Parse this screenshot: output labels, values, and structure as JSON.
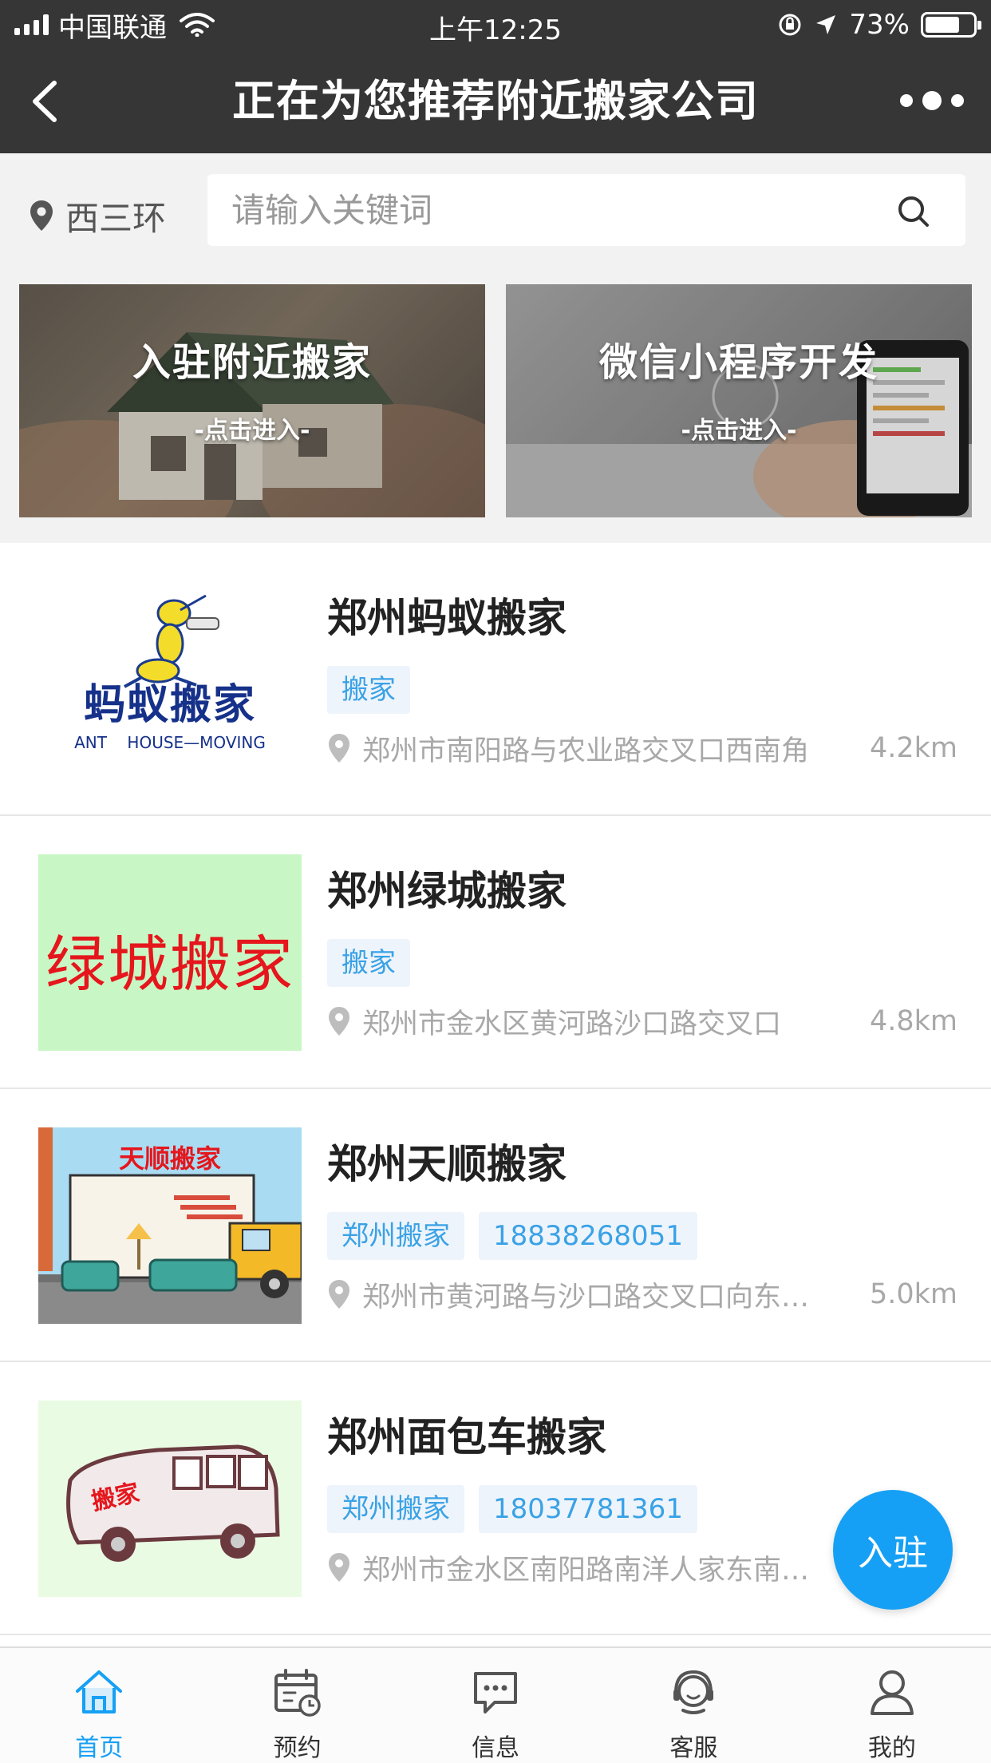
{
  "status_bar": {
    "carrier": "中国联通",
    "time": "上午12:25",
    "battery": "73%",
    "battery_level": 0.73
  },
  "nav": {
    "title": "正在为您推荐附近搬家公司"
  },
  "location": {
    "text": "西三环"
  },
  "search": {
    "placeholder": "请输入关键词"
  },
  "banners": [
    {
      "title": "入驻附近搬家",
      "subtitle": "-点击进入-"
    },
    {
      "title": "微信小程序开发",
      "subtitle": "-点击进入-"
    }
  ],
  "companies": [
    {
      "name": "郑州蚂蚁搬家",
      "tags": [
        "搬家"
      ],
      "address": "郑州市南阳路与农业路交叉口西南角",
      "distance": "4.2km",
      "logo": {
        "text": "蚂蚁搬家",
        "subtext": "ANT    HOUSE—MOVING"
      }
    },
    {
      "name": "郑州绿城搬家",
      "tags": [
        "搬家"
      ],
      "address": "郑州市金水区黄河路沙口路交叉口",
      "distance": "4.8km",
      "logo": {
        "text": "绿城搬家"
      }
    },
    {
      "name": "郑州天顺搬家",
      "tags": [
        "郑州搬家",
        "18838268051"
      ],
      "address": "郑州市黄河路与沙口路交叉口向东…",
      "distance": "5.0km",
      "logo": {
        "text": "天顺搬家"
      }
    },
    {
      "name": "郑州面包车搬家",
      "tags": [
        "郑州搬家",
        "18037781361"
      ],
      "address": "郑州市金水区南阳路南洋人家东南…",
      "distance": "",
      "logo": {
        "text": "搬家"
      }
    }
  ],
  "float_button": {
    "label": "入驻"
  },
  "tabs": [
    {
      "label": "首页",
      "icon": "home-icon",
      "active": true
    },
    {
      "label": "预约",
      "icon": "calendar-icon",
      "active": false
    },
    {
      "label": "信息",
      "icon": "message-icon",
      "active": false
    },
    {
      "label": "客服",
      "icon": "customer-service-icon",
      "active": false
    },
    {
      "label": "我的",
      "icon": "user-icon",
      "active": false
    }
  ],
  "colors": {
    "nav_bg": "#363636",
    "accent": "#16a0f5",
    "tag_text": "#3aa2e6",
    "tag_bg": "#eef4fb"
  }
}
